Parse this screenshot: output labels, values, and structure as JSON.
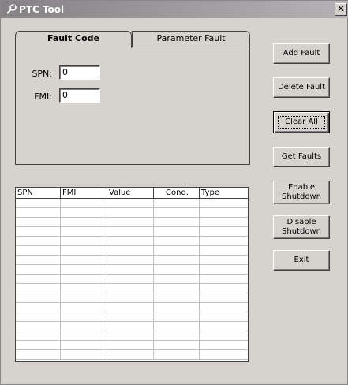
{
  "window": {
    "title": "PTC Tool",
    "close_glyph": "✕"
  },
  "tabs": [
    {
      "label": "Fault Code",
      "active": true
    },
    {
      "label": "Parameter Fault",
      "active": false
    }
  ],
  "form": {
    "spn_label": "SPN:",
    "spn_value": "0",
    "fmi_label": "FMI:",
    "fmi_value": "0"
  },
  "buttons": [
    {
      "label": "Add Fault",
      "name": "add-fault-button"
    },
    {
      "label": "Delete Fault",
      "name": "delete-fault-button"
    },
    {
      "label": "Clear All",
      "name": "clear-all-button"
    },
    {
      "label": "Get Faults",
      "name": "get-faults-button"
    },
    {
      "label": "Enable Shutdown",
      "name": "enable-shutdown-button"
    },
    {
      "label": "Disable Shutdown",
      "name": "disable-shutdown-button"
    },
    {
      "label": "Exit",
      "name": "exit-button"
    }
  ],
  "table": {
    "columns": [
      "SPN",
      "FMI",
      "Value",
      "Cond.",
      "Type"
    ],
    "rows": []
  }
}
